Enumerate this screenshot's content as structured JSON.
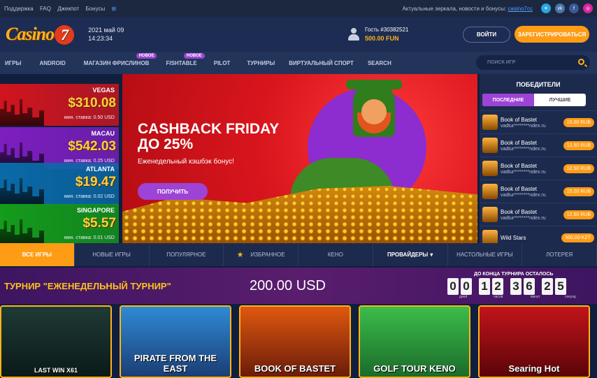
{
  "topbar": {
    "links": [
      "Поддержка",
      "FAQ",
      "Джекпот",
      "Бонусы"
    ],
    "mirrors": "Актуальные зеркала, новости и бонусы:",
    "mirror_link": "casino7cc",
    "social": [
      {
        "name": "telegram-icon",
        "color": "#2aa3df",
        "glyph": "✈"
      },
      {
        "name": "vk-icon",
        "color": "#4a76a8",
        "glyph": "vk"
      },
      {
        "name": "facebook-icon",
        "color": "#3b5998",
        "glyph": "f"
      },
      {
        "name": "instagram-icon",
        "color": "#d6249f",
        "glyph": "◎"
      }
    ]
  },
  "header": {
    "logo": "Casino",
    "logo_seven": "7",
    "date": "2021 май 09",
    "time": "14:23:34",
    "user": "Гость #30382521",
    "balance": "500.00 FUN",
    "login": "ВОЙТИ",
    "register": "ЗАРЕГИСТРИРОВАТЬСЯ"
  },
  "nav": {
    "items": [
      "ИГРЫ",
      "ANDROID",
      "МАГАЗИН ФРИСЛИНОВ",
      "FISHTABLE",
      "PILOT",
      "ТУРНИРЫ",
      "ВИРТУАЛЬНЫЙ СПОРТ",
      "SEARCH"
    ],
    "badge": "НОВОЕ",
    "search_placeholder": "ПОИСК ИГР"
  },
  "jackpots": [
    {
      "name": "VEGAS",
      "amount": "$310.08",
      "min": "мин. ставка: 0.50 USD",
      "color": "#d0151f"
    },
    {
      "name": "MACAU",
      "amount": "$542.03",
      "min": "мин. ставка: 0.25 USD",
      "color": "#7d1ec0"
    },
    {
      "name": "ATLANTA",
      "amount": "$19.47",
      "min": "мин. ставка: 0.02 USD",
      "color": "#0a6aa8"
    },
    {
      "name": "SINGAPORE",
      "amount": "$5.57",
      "min": "мин. ставка: 0.01 USD",
      "color": "#149c1a"
    }
  ],
  "banner": {
    "title1": "CASHBACK FRIDAY",
    "title2": "ДО 25%",
    "subtitle": "Еженедельный кэшбэк бонус!",
    "button": "ПОЛУЧИТЬ"
  },
  "winners": {
    "title": "ПОБЕДИТЕЛИ",
    "tab_recent": "ПОСЛЕДНИЕ",
    "tab_best": "ЛУЧШИЕ",
    "rows": [
      {
        "game": "Book of Bastet",
        "user": "vadtur********ndex.ru",
        "sum": "15.00 RUB"
      },
      {
        "game": "Book of Bastet",
        "user": "vadtur********ndex.ru",
        "sum": "12.50 RUB"
      },
      {
        "game": "Book of Bastet",
        "user": "vadtur********ndex.ru",
        "sum": "12.50 RUB"
      },
      {
        "game": "Book of Bastet",
        "user": "vadtur********ndex.ru",
        "sum": "15.00 RUB"
      },
      {
        "game": "Book of Bastet",
        "user": "vadtur********ndex.ru",
        "sum": "12.50 RUB"
      },
      {
        "game": "Wild Stars",
        "user": "",
        "sum": "500.00 KZT"
      }
    ]
  },
  "categories": [
    "ВСЕ ИГРЫ",
    "НОВЫЕ ИГРЫ",
    "ПОПУЛЯРНОЕ",
    "ИЗБРАННОЕ",
    "КЕНО",
    "ПРОВАЙДЕРЫ",
    "НАСТОЛЬНЫЕ ИГРЫ",
    "ЛОТЕРЕЯ"
  ],
  "tournament": {
    "title": "ТУРНИР \"ЕЖЕНЕДЕЛЬНЫЙ ТУРНИР\"",
    "prize": "200.00 USD",
    "countdown_label": "ДО КОНЦА ТУРНИРА ОСТАЛОСЬ",
    "digits": [
      "0",
      "0",
      "1",
      "2",
      "3",
      "6",
      "2",
      "5"
    ],
    "units": [
      "дней",
      "часов",
      "минут",
      "секунд"
    ]
  },
  "games": [
    {
      "title": "LAST WIN X61",
      "colors": [
        "#1f3a36",
        "#0b1a18"
      ]
    },
    {
      "title": "PIRATE FROM THE EAST",
      "colors": [
        "#2f8ad6",
        "#1a3e74"
      ]
    },
    {
      "title": "BOOK OF BASTET",
      "colors": [
        "#e0580f",
        "#6a1c0a"
      ]
    },
    {
      "title": "GOLF TOUR KENO",
      "colors": [
        "#3bbd4a",
        "#1b6b2a"
      ]
    },
    {
      "title": "Searing Hot",
      "colors": [
        "#c2141b",
        "#5a0408"
      ]
    }
  ]
}
